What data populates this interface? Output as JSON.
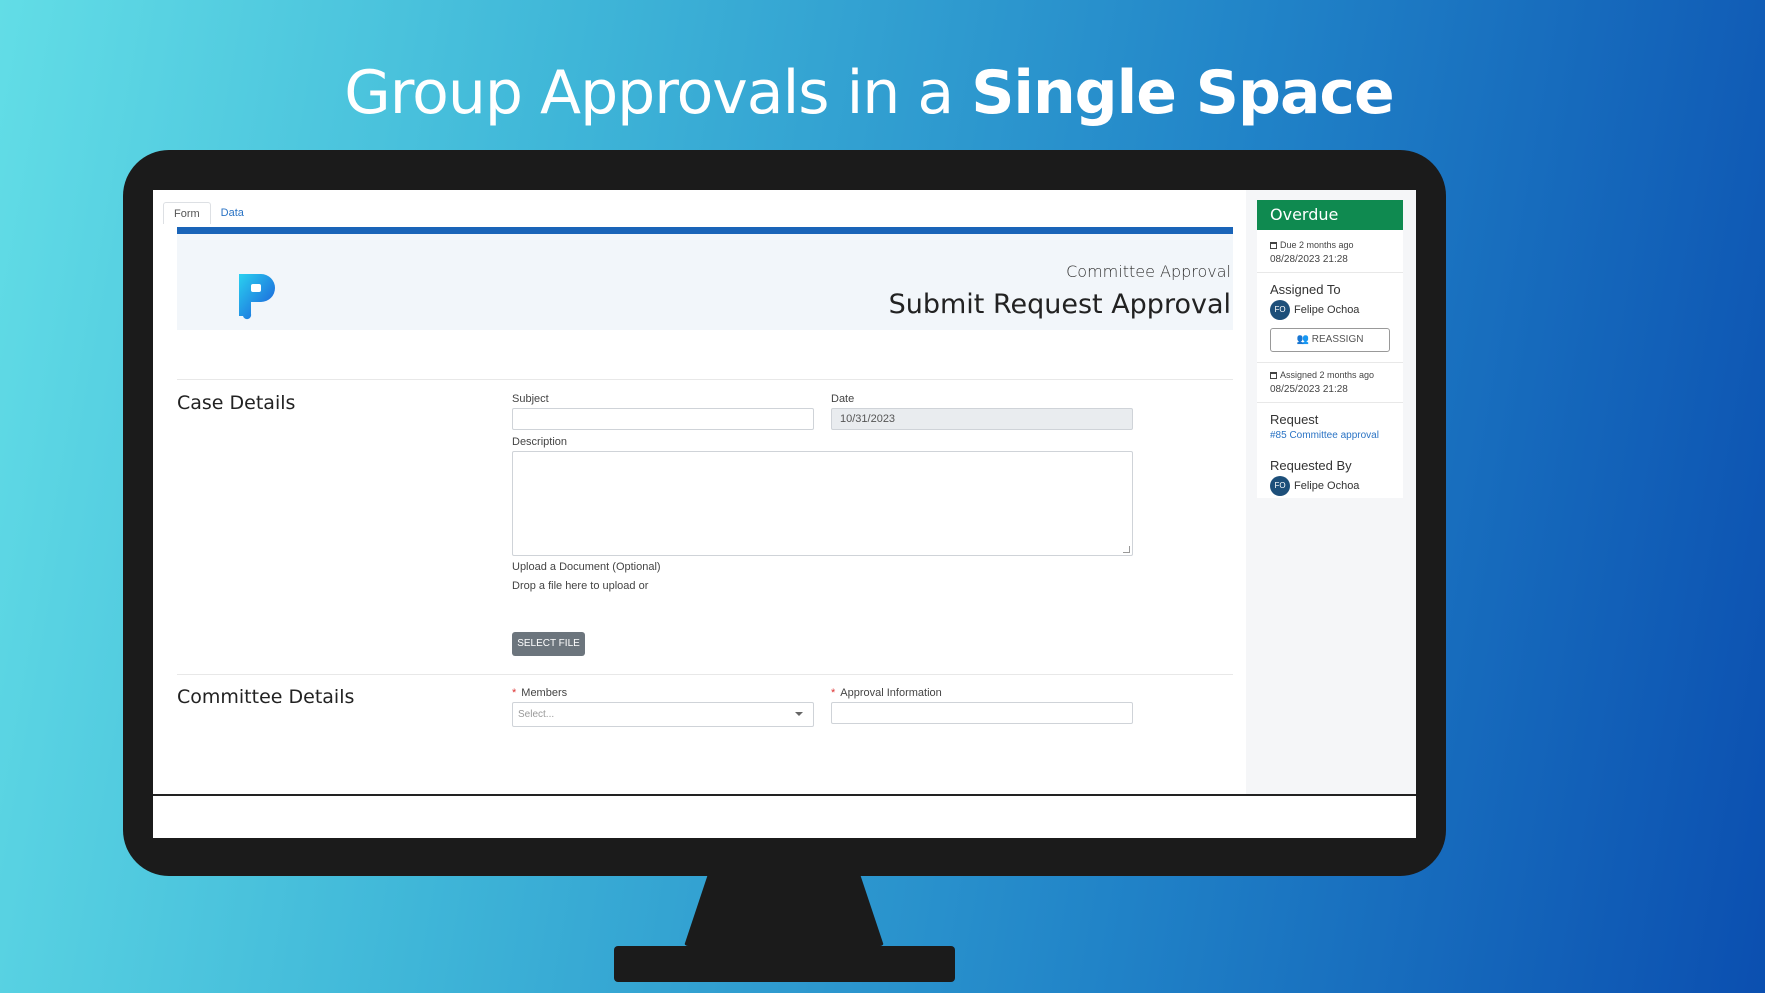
{
  "headline": {
    "regular": "Group Approvals in a ",
    "bold": "Single Space"
  },
  "tabs": [
    "Form",
    "Data"
  ],
  "banner": {
    "subtitle": "Committee Approval",
    "title": "Submit Request Approval"
  },
  "case_details": {
    "title": "Case Details",
    "subject_label": "Subject",
    "subject_value": "",
    "date_label": "Date",
    "date_value": "10/31/2023",
    "description_label": "Description",
    "upload_label": "Upload a Document (Optional)",
    "drop_text": "Drop a file here to upload or",
    "select_file": "SELECT FILE"
  },
  "committee_details": {
    "title": "Committee Details",
    "required_mark": "*",
    "members_label": "Members",
    "members_placeholder": "Select...",
    "approval_label": "Approval Information"
  },
  "sidebar": {
    "status": "Overdue",
    "due_relative": "Due 2 months ago",
    "due_date": "08/28/2023 21:28",
    "assigned_to_label": "Assigned To",
    "assignee_initials": "FO",
    "assignee_name": "Felipe Ochoa",
    "reassign": "REASSIGN",
    "assigned_relative": "Assigned 2 months ago",
    "assigned_date": "08/25/2023 21:28",
    "request_label": "Request",
    "request_link": "#85 Committee approval",
    "requested_by_label": "Requested By",
    "requester_initials": "FO",
    "requester_name": "Felipe Ochoa"
  },
  "colors": {
    "status": "#0f8a50",
    "accent": "#1a64b8",
    "link": "#2a73c4"
  }
}
